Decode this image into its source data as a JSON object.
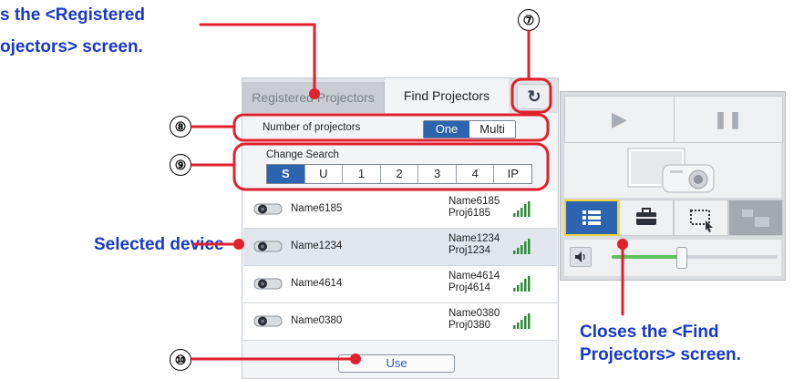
{
  "annotations": {
    "top_left_line1": "s the <Registered",
    "top_left_line2": "ojectors> screen.",
    "selected_device": "Selected device",
    "bottom_right_line1": "Closes the <Find",
    "bottom_right_line2": "Projectors> screen.",
    "callouts": [
      "⑦",
      "⑧",
      "⑨",
      "⑩"
    ]
  },
  "tabs": {
    "registered": "Registered Projectors",
    "find": "Find Projectors"
  },
  "refresh_glyph": "↻",
  "number_of_projectors": {
    "label": "Number of projectors",
    "options": [
      "One",
      "Multi"
    ],
    "selected": "One"
  },
  "change_search": {
    "label": "Change Search",
    "options": [
      "S",
      "U",
      "1",
      "2",
      "3",
      "4",
      "IP"
    ],
    "selected": "S"
  },
  "devices": [
    {
      "name": "Name6185",
      "detail_name": "Name6185",
      "detail_proj": "Proj6185",
      "selected": false
    },
    {
      "name": "Name1234",
      "detail_name": "Name1234",
      "detail_proj": "Proj1234",
      "selected": true
    },
    {
      "name": "Name4614",
      "detail_name": "Name4614",
      "detail_proj": "Proj4614",
      "selected": false
    },
    {
      "name": "Name0380",
      "detail_name": "Name0380",
      "detail_proj": "Proj0380",
      "selected": false
    }
  ],
  "use_button": "Use",
  "control_panel": {
    "play_glyph": "▶",
    "pause_glyph": "❚❚",
    "volume_level": 0.42
  },
  "colors": {
    "accent": "#2d64b0",
    "annotation_text": "#1838c8",
    "annotation_line": "#e0202c",
    "slider": "#5ec05e"
  }
}
